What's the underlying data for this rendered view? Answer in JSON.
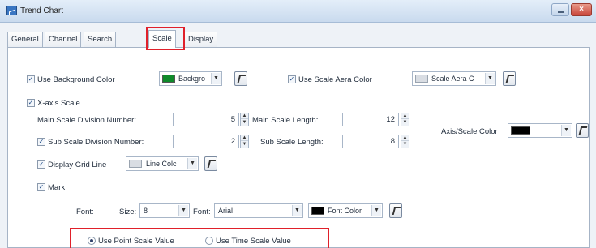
{
  "window": {
    "title": "Trend Chart",
    "close_glyph": "×"
  },
  "tabs": [
    {
      "label": "General"
    },
    {
      "label": "Channel"
    },
    {
      "label": "Search"
    },
    {
      "label": "Scale"
    },
    {
      "label": "Display"
    }
  ],
  "active_tab": "Scale",
  "background": {
    "use_bg_label": "Use Background Color",
    "use_bg_checked": true,
    "bg_combo_text": "Backgro",
    "bg_color": "#0f8a2a",
    "use_scale_area_label": "Use Scale Aera Color",
    "use_scale_area_checked": true,
    "scale_area_combo_text": "Scale Aera C",
    "scale_area_color": "#d9dde3"
  },
  "xaxis": {
    "label": "X-axis Scale",
    "checked": true,
    "main_div_label": "Main Scale Division Number:",
    "main_div_value": "5",
    "main_len_label": "Main Scale Length:",
    "main_len_value": "12",
    "sub_div_label": "Sub Scale Division Number:",
    "sub_div_checked": true,
    "sub_div_value": "2",
    "sub_len_label": "Sub Scale Length:",
    "sub_len_value": "8",
    "axis_color_label": "Axis/Scale Color",
    "axis_color": "#000000",
    "grid_label": "Display Grid Line",
    "grid_checked": true,
    "line_color_combo_text": "Line Colc",
    "line_color": "#d9dde3",
    "mark_label": "Mark",
    "mark_checked": true
  },
  "font_row": {
    "font_label": "Font:",
    "size_label": "Size:",
    "size_value": "8",
    "font2_label": "Font:",
    "font_value": "Arial",
    "font_color_text": "Font Color",
    "font_color": "#000000"
  },
  "scale_value": {
    "point_label": "Use Point Scale Value",
    "point_selected": true,
    "time_label": "Use Time Scale Value",
    "time_selected": false
  },
  "colors": {
    "highlight": "#e0202a",
    "accent": "#3a76c2"
  },
  "glyphs": {
    "check": "✓",
    "down": "▼",
    "up": "▲"
  }
}
